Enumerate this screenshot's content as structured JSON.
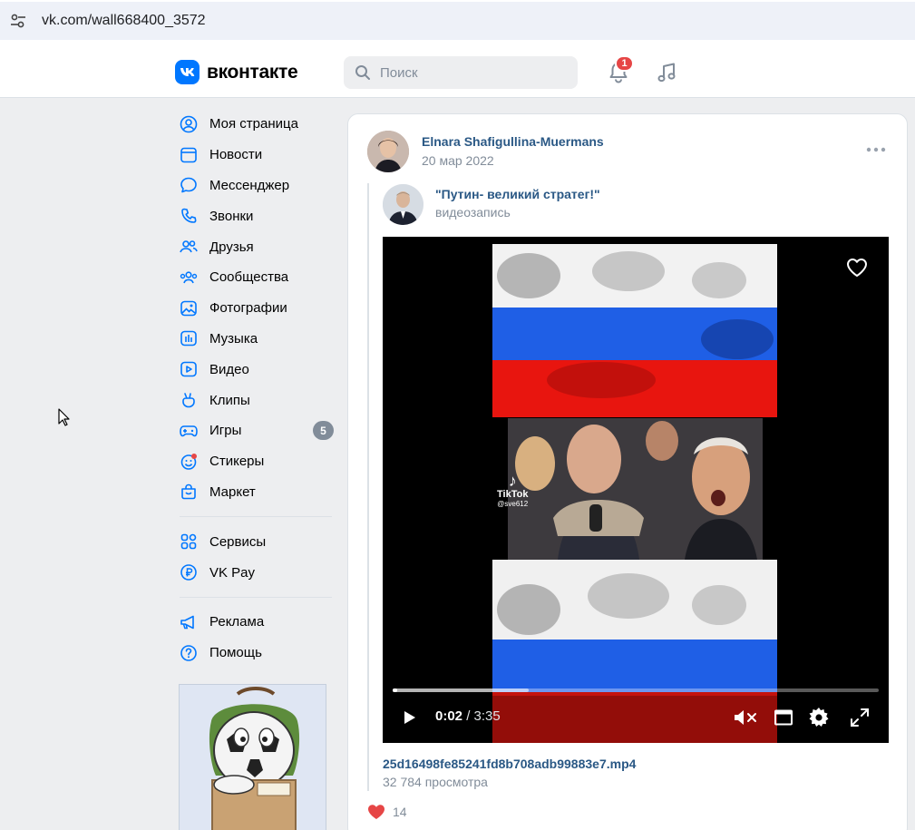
{
  "browser": {
    "url": "vk.com/wall668400_3572"
  },
  "header": {
    "logo_text": "вконтакте",
    "logo_letter": "VK",
    "search_placeholder": "Поиск",
    "notifications_count": "1"
  },
  "sidebar": {
    "items": [
      {
        "label": "Моя страница",
        "icon": "user-circle-icon"
      },
      {
        "label": "Новости",
        "icon": "news-icon"
      },
      {
        "label": "Мессенджер",
        "icon": "message-icon"
      },
      {
        "label": "Звонки",
        "icon": "phone-icon"
      },
      {
        "label": "Друзья",
        "icon": "friends-icon"
      },
      {
        "label": "Сообщества",
        "icon": "communities-icon"
      },
      {
        "label": "Фотографии",
        "icon": "photos-icon"
      },
      {
        "label": "Музыка",
        "icon": "music-icon"
      },
      {
        "label": "Видео",
        "icon": "video-icon"
      },
      {
        "label": "Клипы",
        "icon": "clips-icon"
      },
      {
        "label": "Игры",
        "icon": "gamepad-icon",
        "badge": "5"
      },
      {
        "label": "Стикеры",
        "icon": "sticker-icon"
      },
      {
        "label": "Маркет",
        "icon": "bag-icon"
      }
    ],
    "items2": [
      {
        "label": "Сервисы",
        "icon": "apps-icon"
      },
      {
        "label": "VK Pay",
        "icon": "ruble-icon"
      }
    ],
    "items3": [
      {
        "label": "Реклама",
        "icon": "megaphone-icon"
      },
      {
        "label": "Помощь",
        "icon": "help-icon"
      }
    ]
  },
  "post": {
    "author": "Elnara Shafigullina-Muermans",
    "date": "20 мар 2022",
    "repost": {
      "title": "\"Путин- великий стратег!\"",
      "subtitle": "видеозапись"
    },
    "video": {
      "watermark_brand": "TikTok",
      "watermark_handle": "@sve612",
      "current_time": "0:02",
      "separator": " / ",
      "duration": "3:35",
      "played_fraction": 0.009,
      "buffered_fraction": 0.28
    },
    "filename": "25d16498fe85241fd8b708adb99883e7.mp4",
    "views": "32 784 просмотра",
    "likes": "14"
  },
  "colors": {
    "accent": "#0077ff",
    "link": "#2a5885",
    "muted": "#818c99",
    "like": "#e64646"
  }
}
